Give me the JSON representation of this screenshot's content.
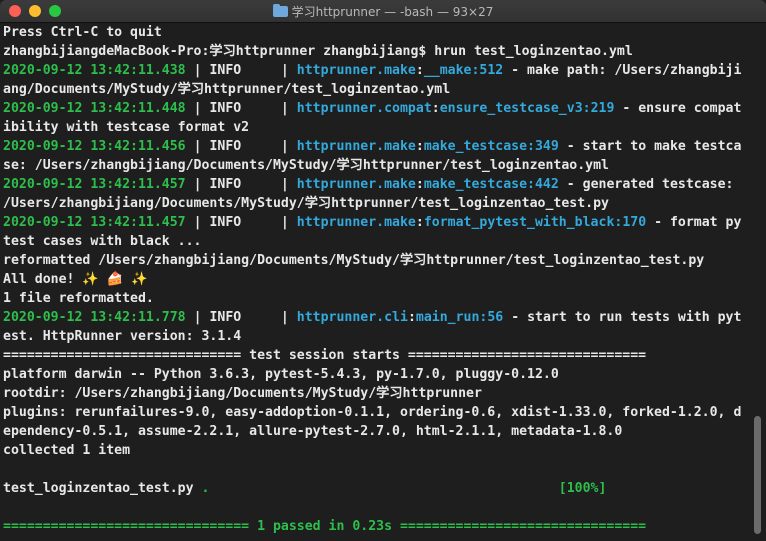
{
  "window": {
    "title": "学习httprunner — -bash — 93×27"
  },
  "colors": {
    "green": "#2dbf4c",
    "cyan": "#33a9dc",
    "yellow": "#d6c229",
    "text": "#e8e8e8",
    "background": "#1e1e1e"
  },
  "terminal": {
    "l1": "Press Ctrl-C to quit",
    "l2": "zhangbijiangdeMacBook-Pro:学习httprunner zhangbijiang$ hrun test_loginzentao.yml",
    "l3": {
      "time": "2020-09-12 13:42:11.438",
      "sep1": " | INFO     | ",
      "mod": "httprunner.make",
      "colon": ":",
      "func": "__make",
      "num": ":512",
      "msg": " - make path: /Users/zhangbiji"
    },
    "l4": "ang/Documents/MyStudy/学习httprunner/test_loginzentao.yml",
    "l5": {
      "time": "2020-09-12 13:42:11.448",
      "sep1": " | INFO     | ",
      "mod": "httprunner.compat",
      "colon": ":",
      "func": "ensure_testcase_v3",
      "num": ":219",
      "msg": " - ensure compat"
    },
    "l6": "ibility with testcase format v2",
    "l7": {
      "time": "2020-09-12 13:42:11.456",
      "sep1": " | INFO     | ",
      "mod": "httprunner.make",
      "colon": ":",
      "func": "make_testcase",
      "num": ":349",
      "msg": " - start to make testca"
    },
    "l8": "se: /Users/zhangbijiang/Documents/MyStudy/学习httprunner/test_loginzentao.yml",
    "l9": {
      "time": "2020-09-12 13:42:11.457",
      "sep1": " | INFO     | ",
      "mod": "httprunner.make",
      "colon": ":",
      "func": "make_testcase",
      "num": ":442",
      "msg": " - generated testcase: "
    },
    "l10": "/Users/zhangbijiang/Documents/MyStudy/学习httprunner/test_loginzentao_test.py",
    "l11": {
      "time": "2020-09-12 13:42:11.457",
      "sep1": " | INFO     | ",
      "mod": "httprunner.make",
      "colon": ":",
      "func": "format_pytest_with_black",
      "num": ":170",
      "msg": " - format py"
    },
    "l12": "test cases with black ...",
    "l13": "reformatted /Users/zhangbijiang/Documents/MyStudy/学习httprunner/test_loginzentao_test.py",
    "l14": "All done! ✨ 🍰 ✨",
    "l15": "1 file reformatted.",
    "l16": {
      "time": "2020-09-12 13:42:11.778",
      "sep1": " | INFO     | ",
      "mod": "httprunner.cli",
      "colon": ":",
      "func": "main_run",
      "num": ":56",
      "msg": " - start to run tests with pyt"
    },
    "l17": "est. HttpRunner version: 3.1.4",
    "l18": "============================== test session starts ==============================",
    "l19": "platform darwin -- Python 3.6.3, pytest-5.4.3, py-1.7.0, pluggy-0.12.0",
    "l20": "rootdir: /Users/zhangbijiang/Documents/MyStudy/学习httprunner",
    "l21": "plugins: rerunfailures-9.0, easy-addoption-0.1.1, ordering-0.6, xdist-1.33.0, forked-1.2.0, d",
    "l22": "ependency-0.5.1, assume-2.2.1, allure-pytest-2.7.0, html-2.1.1, metadata-1.8.0",
    "l23": "collected 1 item",
    "l24": "",
    "l25": {
      "file": "test_loginzentao_test.py ",
      "dot": ".",
      "pad": "                                            ",
      "pct": "[100%]"
    },
    "l26": "",
    "l27": "=============================== 1 passed in 0.23s ==============================="
  }
}
